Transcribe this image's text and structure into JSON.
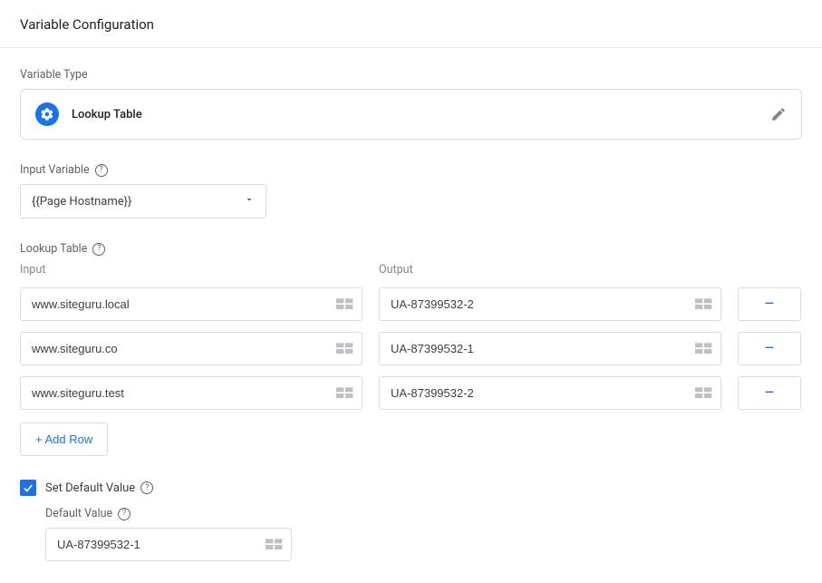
{
  "heading": "Variable Configuration",
  "variable_type": {
    "label": "Variable Type",
    "selected_name": "Lookup Table"
  },
  "input_variable": {
    "label": "Input Variable",
    "value": "{{Page Hostname}}"
  },
  "lookup_table": {
    "label": "Lookup Table",
    "columns": {
      "input": "Input",
      "output": "Output"
    },
    "rows": [
      {
        "input": "www.siteguru.local",
        "output": "UA-87399532-2"
      },
      {
        "input": "www.siteguru.co",
        "output": "UA-87399532-1"
      },
      {
        "input": "www.siteguru.test",
        "output": "UA-87399532-2"
      }
    ],
    "add_row_label": "+ Add Row",
    "remove_label": "–"
  },
  "default": {
    "checkbox_label": "Set Default Value",
    "checked": true,
    "field_label": "Default Value",
    "value": "UA-87399532-1"
  }
}
